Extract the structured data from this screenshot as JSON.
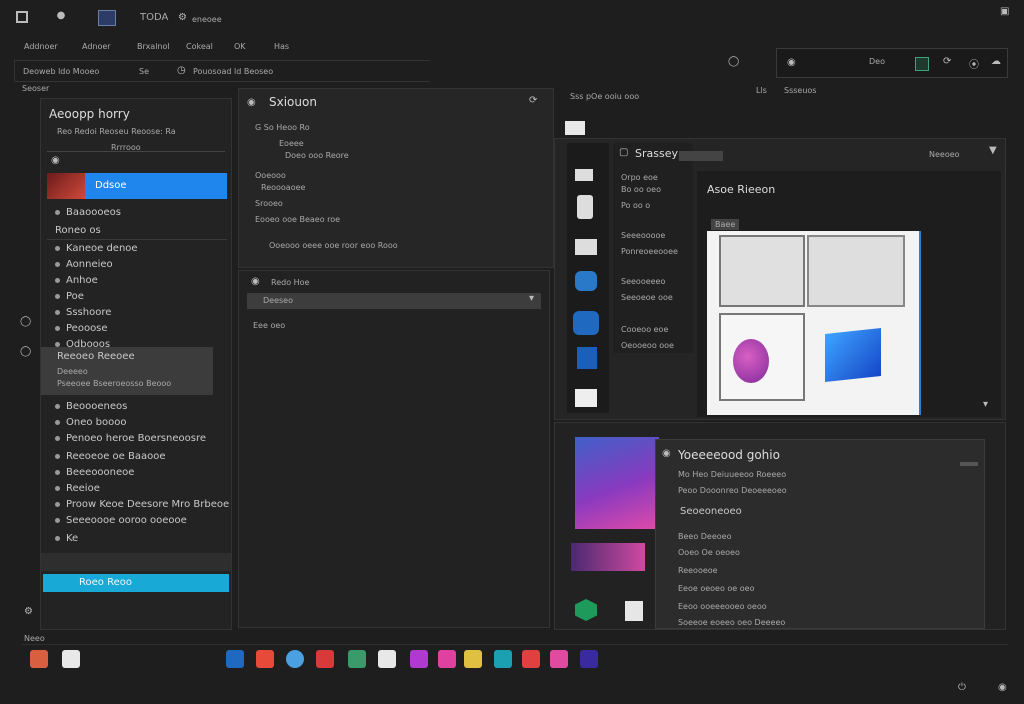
{
  "topbar": {
    "app_label": "TODA",
    "app_sub": "eneoee",
    "menu": [
      "Addnoer",
      "Adnoer",
      "Brxalnol",
      "Cokeal",
      "OK",
      "Has"
    ]
  },
  "toolbar2": {
    "path": "Deoweb ldo Mooeo",
    "tag": "Se",
    "path2": "Pouosoad ld Beoseo",
    "left_label": "Seoser",
    "right_box": "Deo",
    "right_labels": [
      "Lls",
      "Ssseuos"
    ],
    "right_header": "Sss pOe ooiu ooo"
  },
  "left_panel": {
    "title": "Aeoopp horry",
    "filter": "Reo Redoi Reoseu Reoose: Ra",
    "search": "Rrrrooo",
    "selected_item": "Ddsoe",
    "items_a": [
      "Baaoooeos",
      "Roneo os"
    ],
    "items_b": [
      "Kaneoe denoe",
      "Aonneieo",
      "Anhoe",
      "Poe",
      "Ssshoore",
      "Peooose",
      "Odbooos"
    ],
    "highlight_group": {
      "title": "Reeoeo Reeoee",
      "lines": [
        "Deeeeo",
        "Pseeoee Bseeroeosso Beooo"
      ]
    },
    "items_c": [
      "Beoooeneos",
      "Oneo boooo",
      "Penoeo heroe Boersneoosre",
      "Reeoeoe oe Baaooe",
      "Beeeoooneoe",
      "Reeioe",
      "Proow Keoe Deesore Mro Brbeoe",
      "Seeeoooe ooroo ooeooe"
    ],
    "footer_item": "Ke",
    "action_button": "Roeo Reoo"
  },
  "mid_panel": {
    "title": "Sxiouon",
    "lines": [
      "G  So  Heoo Ro",
      "Eoeee",
      "Doeo ooo Reore",
      "Ooeooo",
      "Reoooaoee",
      "Srooeo",
      "Eooeo ooe Beaeo roe",
      "Ooeooo oeee ooe roor eoo Rooo"
    ],
    "section2": "Redo Hoe",
    "input_value": "Deeseo",
    "note": "Eee oeo"
  },
  "right_panel": {
    "toolbar_title": "Srassey",
    "toolbar_right": "Neeoeo",
    "list": [
      "Orpo eoe",
      "Bo oo oeo",
      "Po oo o",
      "Seeeooooe",
      "Ponreoeeooee",
      "Seeooeeeo",
      "Seeoeoe ooe",
      "Cooeoo eoe",
      "Oeooeoo ooe"
    ],
    "canvas_title": "Asoe Rieeon",
    "canvas_tab": "Baee"
  },
  "bottom_panel": {
    "header": "Yoeeeeood gohio",
    "lines": [
      "Mo Heo Deiuueeoo Roeeeo",
      "Peoo Dooonreo Deoeeeoeo"
    ],
    "section": "Seoeoneoeo",
    "list": [
      "Beeo Deeoeo",
      "Ooeo Oe oeoeo",
      "Reeooeoe",
      "Eeoe oeoeo oe oeo",
      "Eeoo ooeeeooeo oeoo",
      "Soeeoe eoeeo oeo Deeeeo"
    ]
  },
  "statusbar": {
    "left": "Neeo"
  },
  "colors": {
    "accent": "#1f86ee",
    "accent2": "#18a9d6",
    "bg": "#1e1e1e",
    "panel": "#262626"
  }
}
